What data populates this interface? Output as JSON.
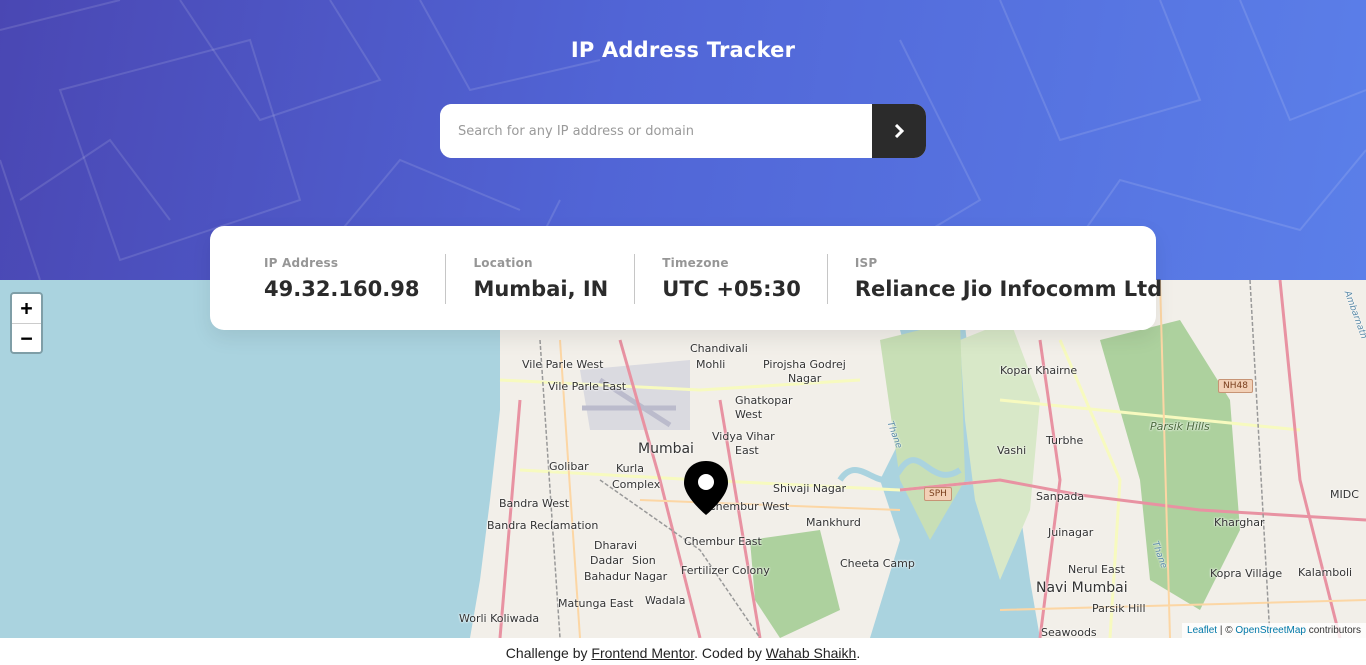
{
  "app": {
    "title": "IP Address Tracker"
  },
  "search": {
    "placeholder": "Search for any IP address or domain",
    "value": "",
    "submit_icon": "chevron-right-icon"
  },
  "stats": [
    {
      "label": "IP Address",
      "value": "49.32.160.98"
    },
    {
      "label": "Location",
      "value": "Mumbai, IN"
    },
    {
      "label": "Timezone",
      "value": "UTC +05:30"
    },
    {
      "label": "ISP",
      "value": "Reliance Jio Infocomm Ltd"
    }
  ],
  "map": {
    "zoom_in": "+",
    "zoom_out": "−",
    "marker_icon": "location-pin-icon",
    "labels": {
      "andheri": "Chandivali",
      "vileparle_w": "Vile Parle West",
      "vileparle_e": "Vile Parle East",
      "mohili": "Mohli",
      "pirojsha": "Pirojsha Godrej",
      "nagar": "Nagar",
      "ghatkopar": "Ghatkopar",
      "west": "West",
      "vidya": "Vidya Vihar",
      "east": "East",
      "mumbai": "Mumbai",
      "golibar": "Golibar",
      "kurla": "Kurla",
      "complex": "Complex",
      "bandra_w": "Bandra West",
      "bandra_rec": "Bandra Reclamation",
      "shivaji": "Shivaji Nagar",
      "chembur_w": "Chembur West",
      "mankhurd": "Mankhurd",
      "dharavi": "Dharavi",
      "chembur_e": "Chembur East",
      "sion": "Sion",
      "dadar": "Dadar",
      "bahadur": "Bahadur Nagar",
      "fertilizer": "Fertilizer Colony",
      "cheeta": "Cheeta Camp",
      "matunga": "Matunga East",
      "wadala": "Wadala",
      "worli": "Worli Koliwada",
      "kopar": "Kopar Khairne",
      "turbhe": "Turbhe",
      "vashi": "Vashi",
      "sanpada": "Sanpada",
      "juinagar": "Juinagar",
      "nerul": "Nerul East",
      "navi": "Navi Mumbai",
      "parsik": "Parsik Hill",
      "seawoods": "Seawoods",
      "kharghar": "Kharghar",
      "kopra": "Kopra Village",
      "kalamboli": "Kalamboli",
      "midc": "MIDC",
      "parsik_hills": "Parsik Hills",
      "nh48": "NH48",
      "sph": "SPH",
      "thane": "Thane",
      "thane2": "Thane",
      "ambarnath": "Ambarnath"
    },
    "attribution": {
      "leaflet": "Leaflet",
      "sep": " | © ",
      "osm": "OpenStreetMap",
      "contributors": " contributors"
    }
  },
  "footer": {
    "prefix": "Challenge by ",
    "challenge_link": "Frontend Mentor",
    "middle": ". Coded by ",
    "author_link": "Wahab Shaikh",
    "suffix": "."
  },
  "colors": {
    "hero_start": "#4a47b3",
    "hero_end": "#5b7fe9",
    "button_dark": "#2b2b2b",
    "water": "#aad3df"
  }
}
